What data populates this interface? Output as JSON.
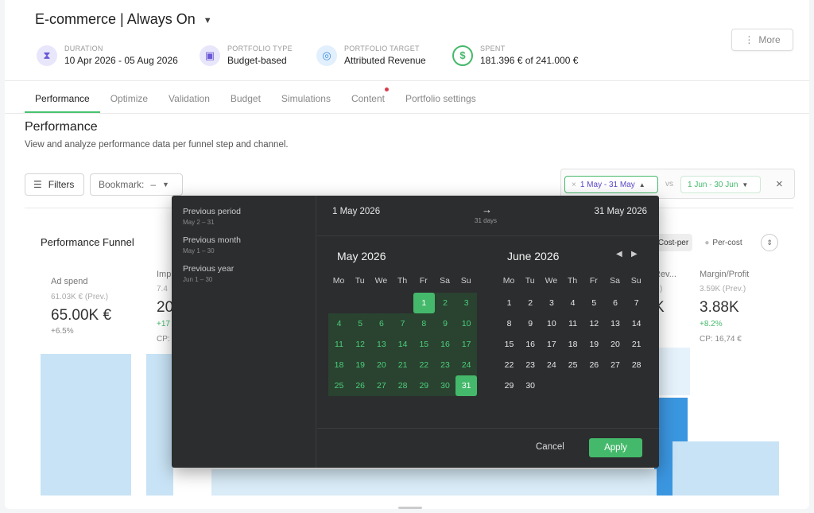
{
  "header": {
    "title": "E-commerce | Always On",
    "more_label": "More",
    "meta": [
      {
        "key": "DURATION",
        "value": "10 Apr 2026 - 05 Aug 2026"
      },
      {
        "key": "PORTFOLIO TYPE",
        "value": "Budget-based"
      },
      {
        "key": "PORTFOLIO TARGET",
        "value": "Attributed Revenue"
      },
      {
        "key": "SPENT",
        "value": "181.396 € of 241.000 €"
      }
    ]
  },
  "tabs": [
    "Performance",
    "Optimize",
    "Validation",
    "Budget",
    "Simulations",
    "Content",
    "Portfolio settings"
  ],
  "performance": {
    "title": "Performance",
    "subtitle": "View and analyze performance data per funnel step and channel.",
    "filters_label": "Filters",
    "bookmark_label": "Bookmark:",
    "bookmark_value": "–",
    "range": "1 May - 31 May",
    "vs": "vs",
    "compare_range": "1 Jun - 30 Jun"
  },
  "funnel": {
    "title": "Performance Funnel",
    "toggle_a": "Cost-per",
    "toggle_b": "Per-cost",
    "ad_spend": {
      "label": "Ad spend",
      "prev": "61.03K € (Prev.)",
      "value": "65.00K €",
      "delta": "+6.5%"
    },
    "impressions": {
      "label": "Imp",
      "prev": "7.4",
      "value": "20",
      "delta": "+17",
      "cp": "CP:"
    },
    "revenue": {
      "label": "Rev...",
      "prev": "v.)",
      "value": "K"
    },
    "margin": {
      "label": "Margin/Profit",
      "prev": "3.59K (Prev.)",
      "value": "3.88K",
      "delta": "+8.2%",
      "cp": "CP: 16,74 €"
    }
  },
  "datepicker": {
    "presets": [
      {
        "label": "Previous period",
        "sub": "May 2 – 31"
      },
      {
        "label": "Previous month",
        "sub": "May 1 – 30"
      },
      {
        "label": "Previous year",
        "sub": "Jun 1 – 30"
      }
    ],
    "start": "1 May 2026",
    "end": "31 May 2026",
    "duration": "31 days",
    "weekdays": [
      "Mo",
      "Tu",
      "We",
      "Th",
      "Fr",
      "Sa",
      "Su"
    ],
    "months": [
      {
        "name": "May 2026",
        "offset": 4,
        "days": 31
      },
      {
        "name": "June 2026",
        "offset": 0,
        "days": 30
      }
    ],
    "cancel_label": "Cancel",
    "apply_label": "Apply"
  },
  "colors": {
    "accent": "#45b96b",
    "popup_bg": "#2c2d2f",
    "funnel_bar": "#c8e3f5",
    "funnel_bar_dark": "#3b96e0"
  }
}
